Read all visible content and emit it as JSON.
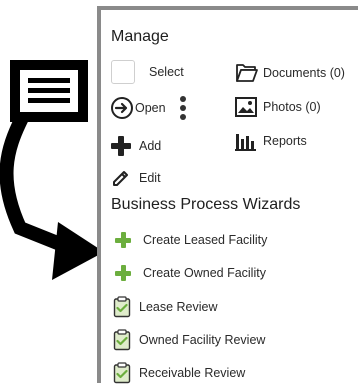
{
  "colors": {
    "panel_border": "#8a8a8a",
    "green_plus": "#6cae3e",
    "heading_text": "#202020"
  },
  "manage": {
    "title": "Manage",
    "select_label": "Select",
    "open_label": "Open",
    "add_label": "Add",
    "edit_label": "Edit",
    "documents_label": "Documents (0)",
    "photos_label": "Photos (0)",
    "reports_label": "Reports"
  },
  "wizards": {
    "title": "Business Process Wizards",
    "items": [
      {
        "label": "Create Leased Facility",
        "icon": "green-plus-icon"
      },
      {
        "label": "Create Owned Facility",
        "icon": "green-plus-icon"
      },
      {
        "label": "Lease Review",
        "icon": "clipboard-check-icon"
      },
      {
        "label": "Owned Facility Review",
        "icon": "clipboard-check-icon"
      },
      {
        "label": "Receivable Review",
        "icon": "clipboard-check-icon"
      }
    ]
  }
}
